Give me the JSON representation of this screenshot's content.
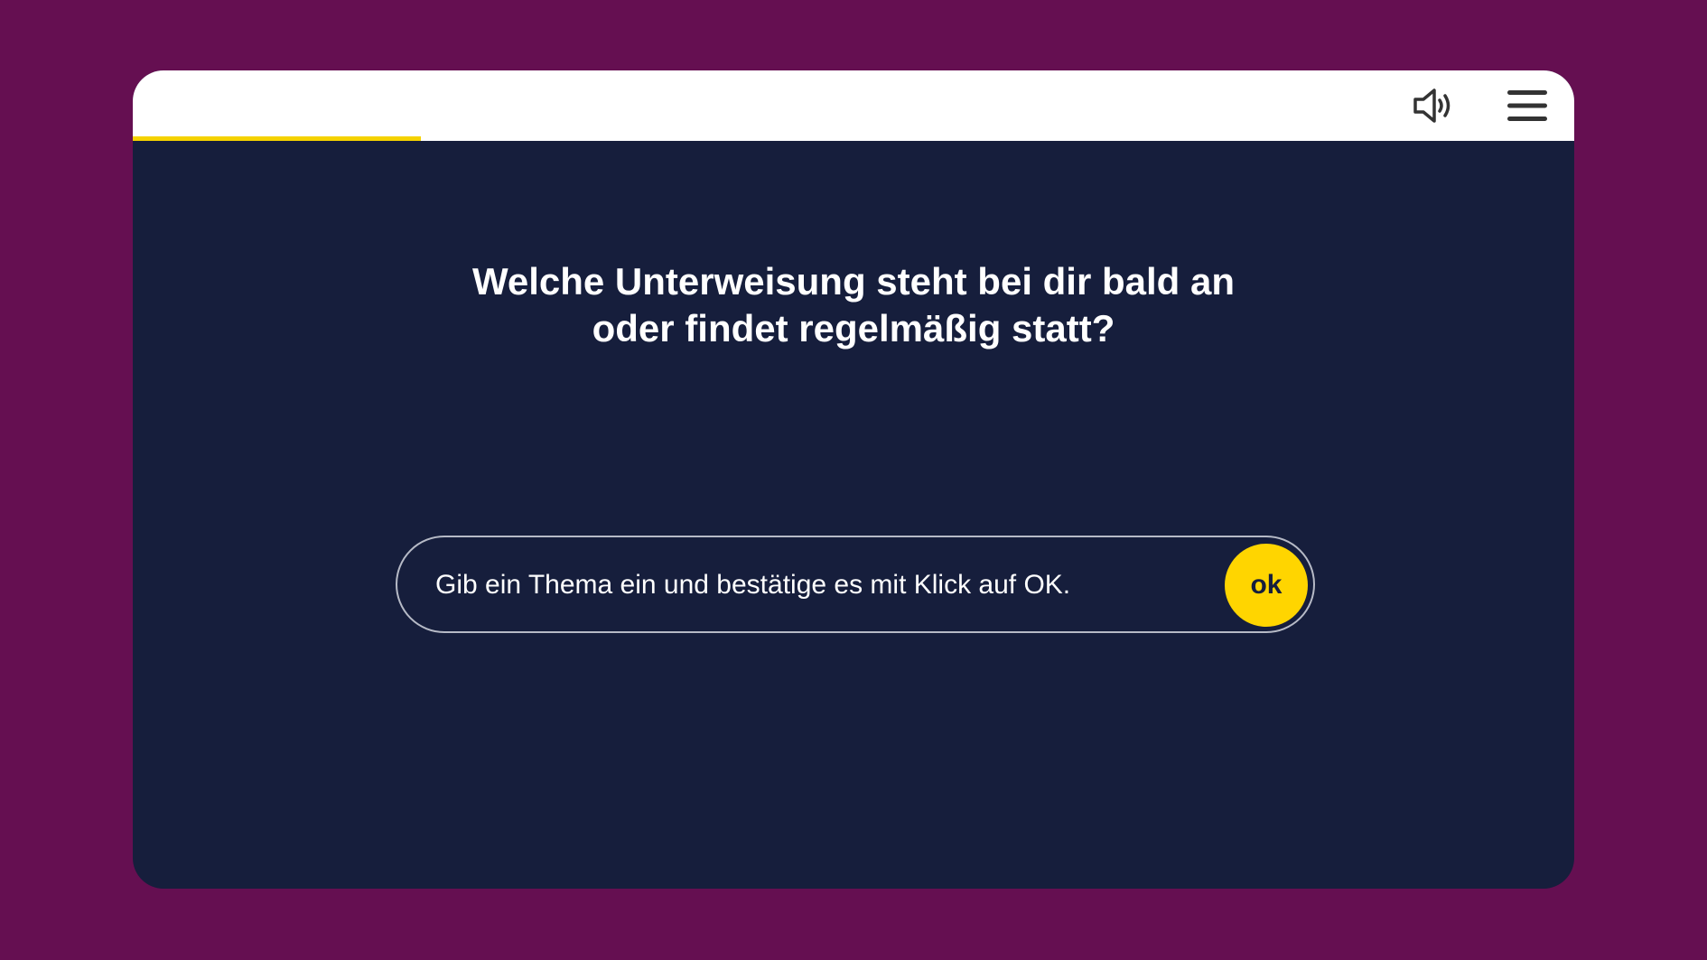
{
  "header": {
    "progress_percent": 20,
    "progress_color": "#f5d200",
    "sound_icon": "speaker-volume-icon",
    "menu_icon": "hamburger-menu-icon"
  },
  "question": {
    "line1": "Welche Unterweisung steht bei dir bald an",
    "line2": "oder findet regelmäßig statt?"
  },
  "answer": {
    "placeholder": "Gib ein Thema ein und bestätige es mit Klick auf OK.",
    "value": "",
    "submit_label": "ok"
  },
  "colors": {
    "page_background": "#650f51",
    "card_background": "#161e3c",
    "accent": "#ffd500",
    "topbar": "#ffffff"
  }
}
